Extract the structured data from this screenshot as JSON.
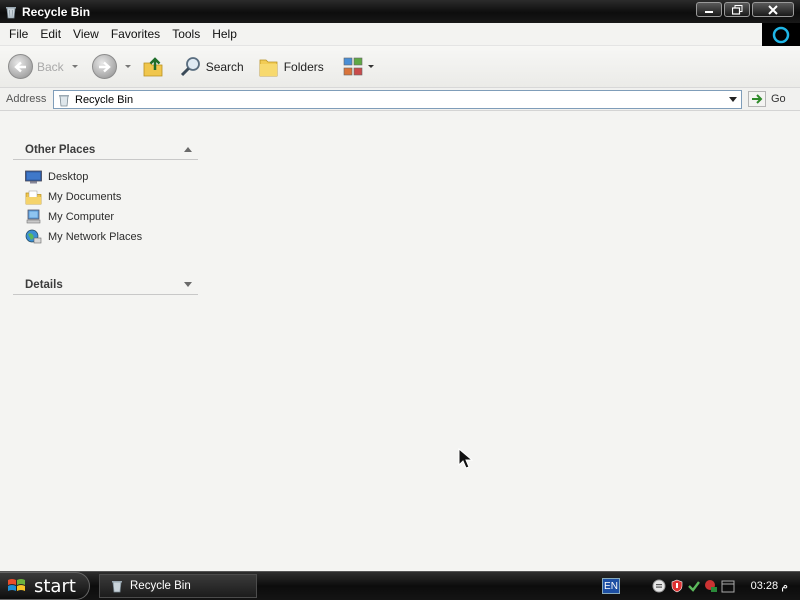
{
  "window": {
    "title": "Recycle Bin",
    "controls": [
      "minimize",
      "restore",
      "close"
    ]
  },
  "menubar": {
    "items": [
      "File",
      "Edit",
      "View",
      "Favorites",
      "Tools",
      "Help"
    ]
  },
  "toolbar": {
    "back_label": "Back",
    "search_label": "Search",
    "folders_label": "Folders"
  },
  "address": {
    "label": "Address",
    "value": "Recycle Bin",
    "go_label": "Go"
  },
  "sidebar": {
    "other_places": {
      "title": "Other Places",
      "items": [
        {
          "label": "Desktop",
          "icon": "desktop-icon"
        },
        {
          "label": "My Documents",
          "icon": "my-documents-icon"
        },
        {
          "label": "My Computer",
          "icon": "my-computer-icon"
        },
        {
          "label": "My Network Places",
          "icon": "network-places-icon"
        }
      ]
    },
    "details": {
      "title": "Details"
    }
  },
  "taskbar": {
    "start_label": "start",
    "task_label": "Recycle Bin",
    "language": "EN",
    "clock": "03:28 م"
  },
  "colors": {
    "content_bg": "#f4f4f2",
    "titlebar": "#1a1a1a",
    "taskbar": "#141414",
    "address_border": "#7f9db9"
  }
}
